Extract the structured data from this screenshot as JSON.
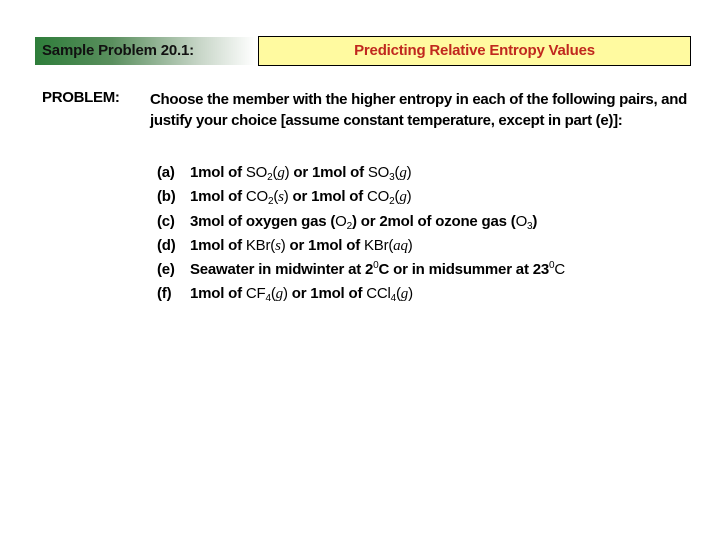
{
  "header": {
    "sample_label": "Sample Problem 20.1:",
    "title": "Predicting Relative Entropy Values",
    "colors": {
      "sample_gradient_start": "#2e7d3a",
      "title_bg": "#fffaa0",
      "title_text": "#c0281e"
    }
  },
  "problem": {
    "label": "PROBLEM:",
    "text": "Choose the member with the higher entropy in each of the following pairs, and justify your choice [assume constant temperature, except in part (e)]:"
  },
  "items": [
    {
      "label": "(a)",
      "parts": {
        "p1": "1mol of ",
        "f1": "SO",
        "s1": "2",
        "st1": "g",
        "mid": " or 1mol of ",
        "f2": "SO",
        "s2": "3",
        "st2": "g"
      }
    },
    {
      "label": "(b)",
      "parts": {
        "p1": "1mol of ",
        "f1": "CO",
        "s1": "2",
        "st1": "s",
        "mid": " or 1mol of ",
        "f2": "CO",
        "s2": "2",
        "st2": "g"
      }
    },
    {
      "label": "(c)",
      "parts": {
        "p1": "3mol of oxygen gas (",
        "f1": "O",
        "s1": "2",
        "mid": ") or 2mol of ozone gas (",
        "f2": "O",
        "s2": "3",
        "end": ")"
      }
    },
    {
      "label": "(d)",
      "parts": {
        "p1": "1mol of ",
        "f1": "KBr",
        "st1": "s",
        "mid": " or 1mol of ",
        "f2": "KBr",
        "st2": "aq"
      }
    },
    {
      "label": "(e)",
      "parts": {
        "p1": "Seawater in midwinter at 2",
        "sup1": "0",
        "mid": "C or in midsummer at 23",
        "sup2": "0",
        "end": "C"
      }
    },
    {
      "label": "(f)",
      "parts": {
        "p1": "1mol of ",
        "f1": "CF",
        "s1": "4",
        "st1": "g",
        "mid": " or 1mol of ",
        "f2": "CCl",
        "s2": "4",
        "st2": "g"
      }
    }
  ]
}
